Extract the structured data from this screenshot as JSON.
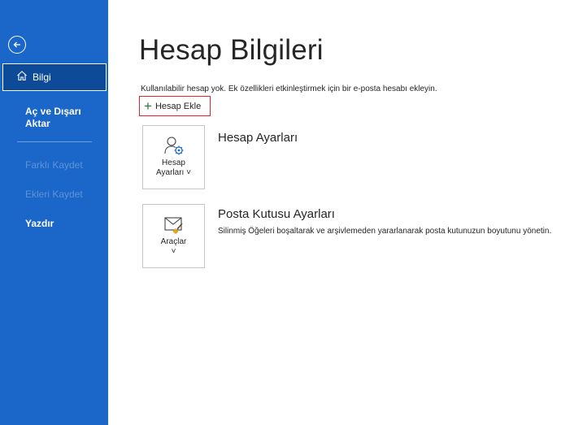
{
  "sidebar": {
    "back_icon": "back-arrow-icon",
    "items": [
      {
        "label": "Bilgi",
        "icon": "home-icon",
        "selected": true
      },
      {
        "label": "Aç ve Dışarı Aktar"
      },
      {
        "label": "Farklı Kaydet",
        "disabled": true
      },
      {
        "label": "Ekleri Kaydet",
        "disabled": true
      },
      {
        "label": "Yazdır"
      }
    ]
  },
  "main": {
    "title": "Hesap Bilgileri",
    "description": "Kullanılabilir hesap yok. Ek özellikleri etkinleştirmek için bir e-posta hesabı ekleyin.",
    "add_account_label": "Hesap Ekle",
    "sections": [
      {
        "tile_label_line1": "Hesap",
        "tile_label_line2": "Ayarları ˅",
        "tile_icon": "account-settings-icon",
        "title": "Hesap Ayarları",
        "description": ""
      },
      {
        "tile_label_line1": "Araçlar",
        "tile_label_line2": "˅",
        "tile_icon": "mailbox-cleanup-icon",
        "title": "Posta Kutusu Ayarları",
        "description": "Silinmiş Öğeleri boşaltarak ve arşivlemeden yararlanarak posta kutunuzun boyutunu yönetin."
      }
    ]
  },
  "colors": {
    "sidebar": "#1b66c9",
    "sidebar_selected": "#0d4a97",
    "highlight_border": "#e0232f",
    "plus_icon": "#1e7b35"
  }
}
